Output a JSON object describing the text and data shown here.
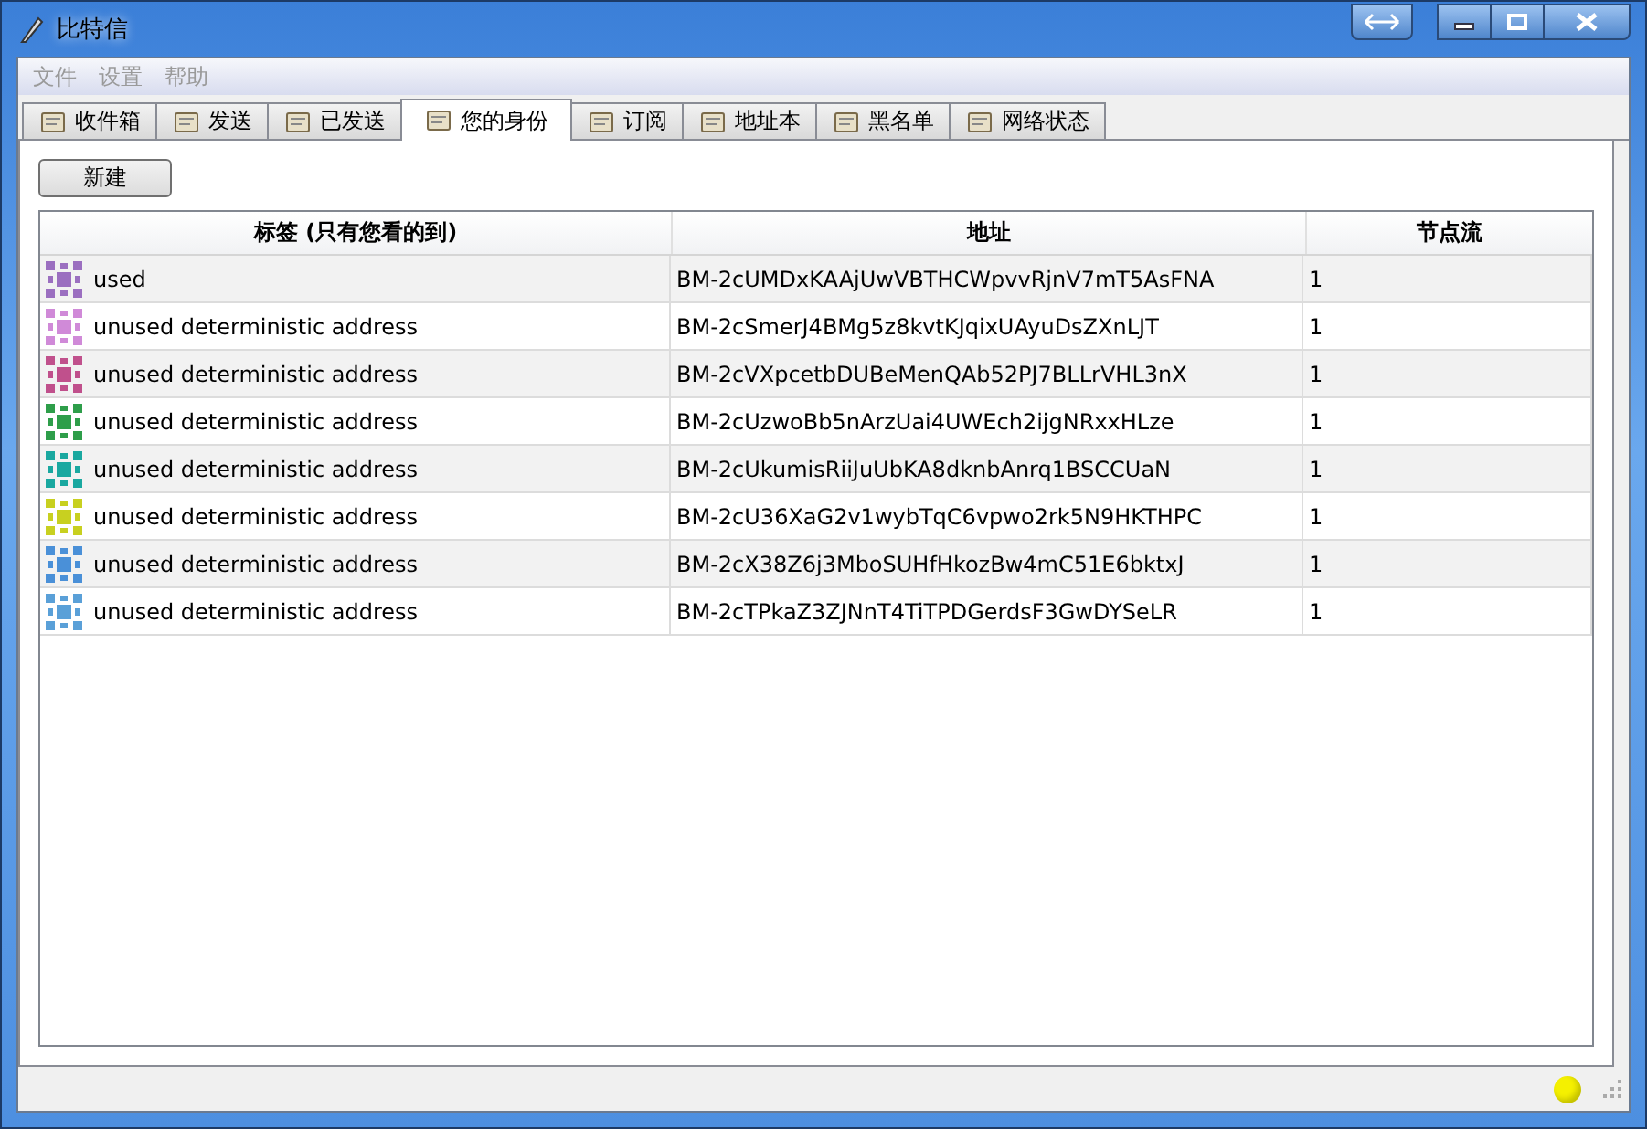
{
  "window": {
    "title": "比特信"
  },
  "menu": [
    "文件",
    "设置",
    "帮助"
  ],
  "tabs": [
    {
      "label": "收件箱",
      "selected": false
    },
    {
      "label": "发送",
      "selected": false
    },
    {
      "label": "已发送",
      "selected": false
    },
    {
      "label": "您的身份",
      "selected": true
    },
    {
      "label": "订阅",
      "selected": false
    },
    {
      "label": "地址本",
      "selected": false
    },
    {
      "label": "黑名单",
      "selected": false
    },
    {
      "label": "网络状态",
      "selected": false
    }
  ],
  "new_button": "新建",
  "table": {
    "columns": [
      "标签 (只有您看的到)",
      "地址",
      "节点流"
    ],
    "rows": [
      {
        "label": "used",
        "address": "BM-2cUMDxKAAjUwVBTHCWpvvRjnV7mT5AsFNA",
        "stream": "1",
        "color": "#9b6fc0"
      },
      {
        "label": "unused deterministic address",
        "address": "BM-2cSmerJ4BMg5z8kvtKJqixUAyuDsZXnLJT",
        "stream": "1",
        "color": "#d08ad8"
      },
      {
        "label": "unused deterministic address",
        "address": "BM-2cVXpcetbDUBeMenQAb52PJ7BLLrVHL3nX",
        "stream": "1",
        "color": "#c0508c"
      },
      {
        "label": "unused deterministic address",
        "address": "BM-2cUzwoBb5nArzUai4UWEch2ijgNRxxHLze",
        "stream": "1",
        "color": "#2e9e4a"
      },
      {
        "label": "unused deterministic address",
        "address": "BM-2cUkumisRiiJuUbKA8dknbAnrq1BSCCUaN",
        "stream": "1",
        "color": "#1aa8a0"
      },
      {
        "label": "unused deterministic address",
        "address": "BM-2cU36XaG2v1wybTqC6vpwo2rk5N9HKTHPC",
        "stream": "1",
        "color": "#c8d020"
      },
      {
        "label": "unused deterministic address",
        "address": "BM-2cX38Z6j3MboSUHfHkozBw4mC51E6bktxJ",
        "stream": "1",
        "color": "#4a90d8"
      },
      {
        "label": "unused deterministic address",
        "address": "BM-2cTPkaZ3ZJNnT4TiTPDGerdsF3GwDYSeLR",
        "stream": "1",
        "color": "#5aa0d8"
      }
    ]
  },
  "status_bar": {
    "color": "#f5f000"
  }
}
